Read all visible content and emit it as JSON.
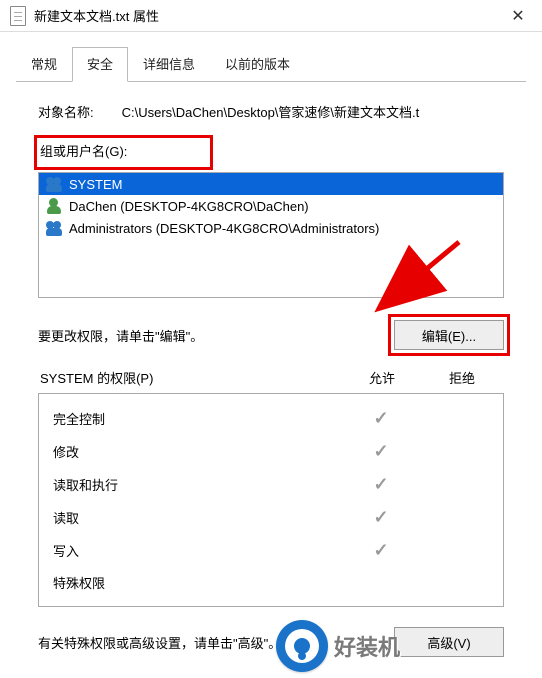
{
  "title": "新建文本文档.txt 属性",
  "tabs": {
    "general": "常规",
    "security": "安全",
    "details": "详细信息",
    "previous": "以前的版本"
  },
  "object": {
    "label": "对象名称:",
    "value": "C:\\Users\\DaChen\\Desktop\\管家速修\\新建文本文档.t"
  },
  "group_label": "组或用户名(G):",
  "users": [
    {
      "name": "SYSTEM",
      "icon": "users",
      "selected": true
    },
    {
      "name": "DaChen (DESKTOP-4KG8CRO\\DaChen)",
      "icon": "user",
      "selected": false
    },
    {
      "name": "Administrators (DESKTOP-4KG8CRO\\Administrators)",
      "icon": "users",
      "selected": false
    }
  ],
  "edit_hint": "要更改权限，请单击\"编辑\"。",
  "edit_button": "编辑(E)...",
  "perm_header": {
    "title": "SYSTEM 的权限(P)",
    "allow": "允许",
    "deny": "拒绝"
  },
  "permissions": [
    {
      "name": "完全控制",
      "allow": true,
      "deny": false
    },
    {
      "name": "修改",
      "allow": true,
      "deny": false
    },
    {
      "name": "读取和执行",
      "allow": true,
      "deny": false
    },
    {
      "name": "读取",
      "allow": true,
      "deny": false
    },
    {
      "name": "写入",
      "allow": true,
      "deny": false
    },
    {
      "name": "特殊权限",
      "allow": false,
      "deny": false
    }
  ],
  "advanced_hint": "有关特殊权限或高级设置，请单击\"高级\"。",
  "advanced_button": "高级(V)",
  "watermark": "好装机"
}
